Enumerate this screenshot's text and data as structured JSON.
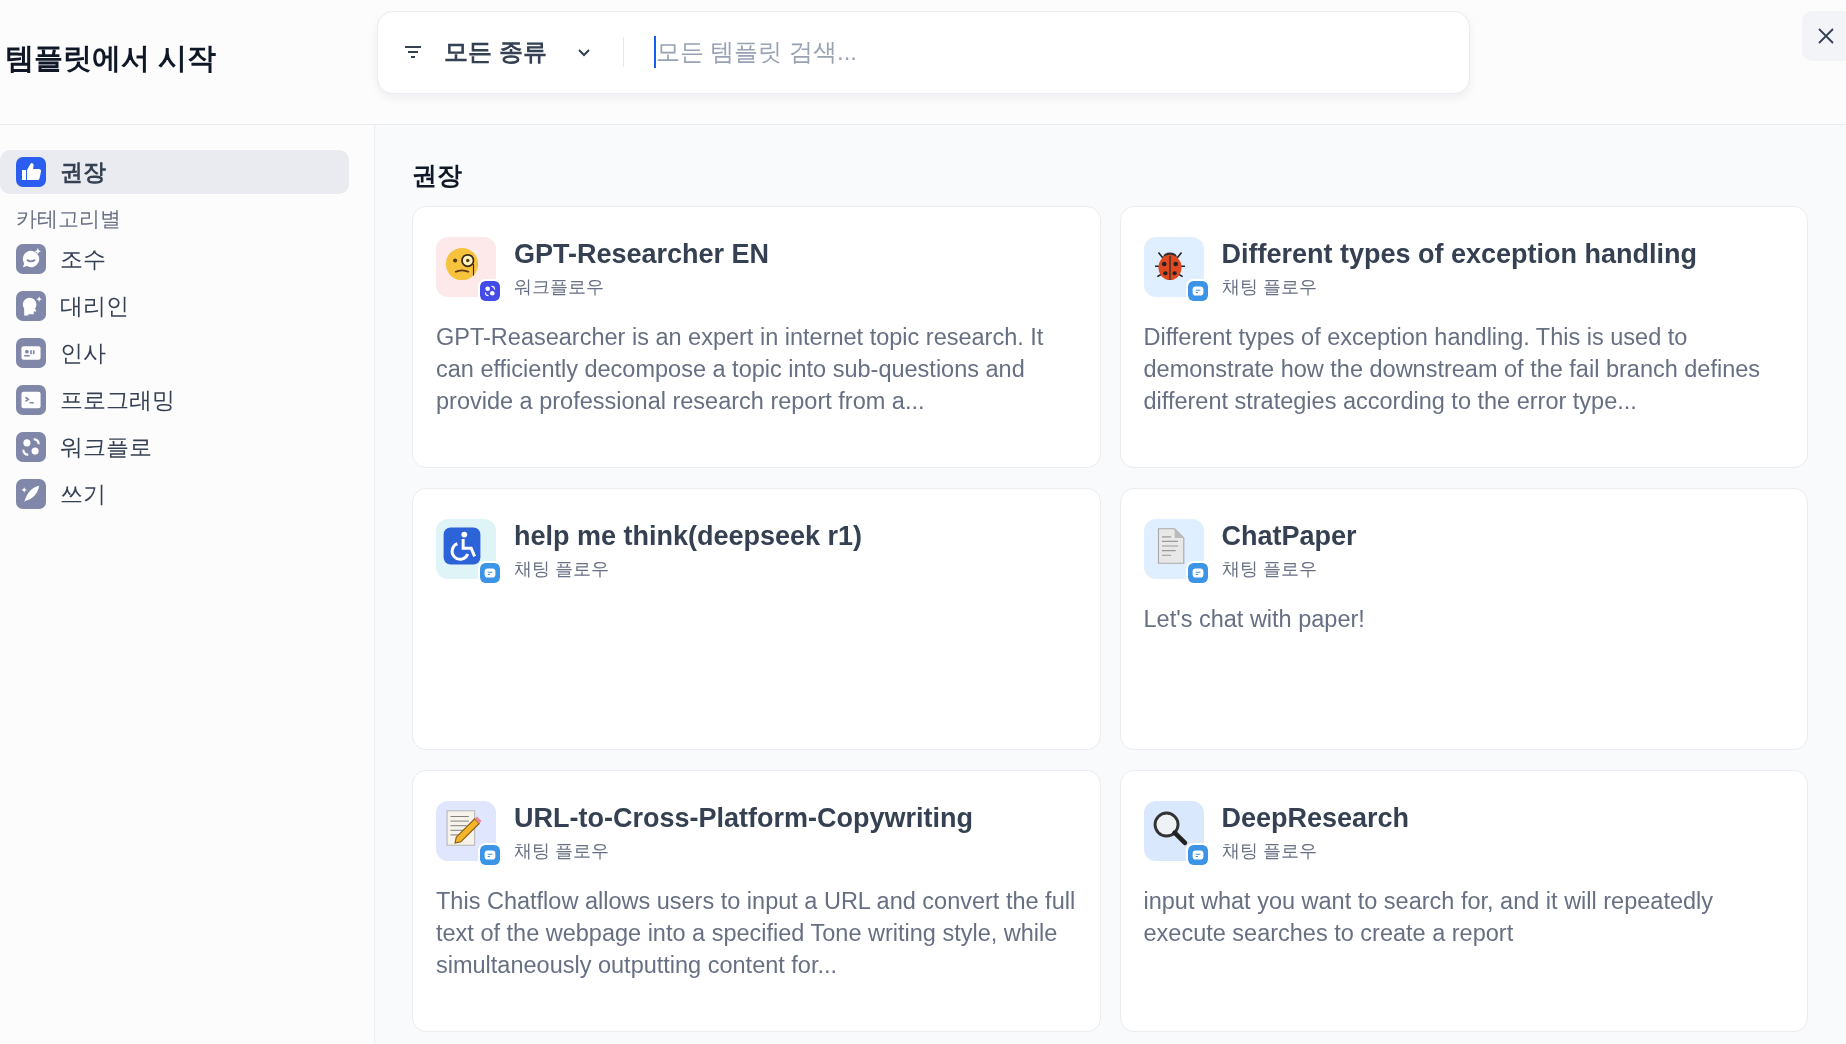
{
  "title": "템플릿에서 시작",
  "search": {
    "filter_label": "모든 종류",
    "placeholder": "모든 템플릿 검색..."
  },
  "sidebar": {
    "top_item": {
      "label": "권장",
      "selected": true
    },
    "section_title": "카테고리별",
    "categories": [
      {
        "label": "조수",
        "selected": false
      },
      {
        "label": "대리인",
        "selected": false
      },
      {
        "label": "인사",
        "selected": false
      },
      {
        "label": "프로그래밍",
        "selected": false
      },
      {
        "label": "워크플로",
        "selected": false
      },
      {
        "label": "쓰기",
        "selected": false
      }
    ]
  },
  "section_heading": "권장",
  "cards": [
    {
      "title": "GPT-Researcher EN",
      "kind": "workflow",
      "type_label": "워크플로우",
      "color": "#fde8ea",
      "description": "GPT-Reasearcher is an expert in internet topic research. It can efficiently decompose a topic into sub-questions and provide a professional research report from a..."
    },
    {
      "title": "Different types of exception handling",
      "kind": "chat",
      "type_label": "채팅 플로우",
      "color": "#e0efff",
      "description": "Different types of exception handling. This is used to demonstrate how the downstream of the fail branch defines different strategies according to the error type..."
    },
    {
      "title": "help me think(deepseek r1)",
      "kind": "chat",
      "type_label": "채팅 플로우",
      "color": "#dff4f7"
    },
    {
      "title": "ChatPaper",
      "kind": "chat",
      "type_label": "채팅 플로우",
      "color": "#e0efff",
      "description": "Let's chat with paper!"
    },
    {
      "title": "URL-to-Cross-Platform-Copywriting",
      "kind": "chat",
      "type_label": "채팅 플로우",
      "color": "#dfe6fd",
      "description": "This Chatflow allows users to input a URL and convert the full text of the webpage into a specified Tone writing style, while simultaneously outputting content for..."
    },
    {
      "title": "DeepResearch",
      "kind": "chat",
      "type_label": "채팅 플로우",
      "color": "#d9e8fc",
      "description": "input what you want to search for, and it will repeatedly execute searches to create a report"
    }
  ]
}
